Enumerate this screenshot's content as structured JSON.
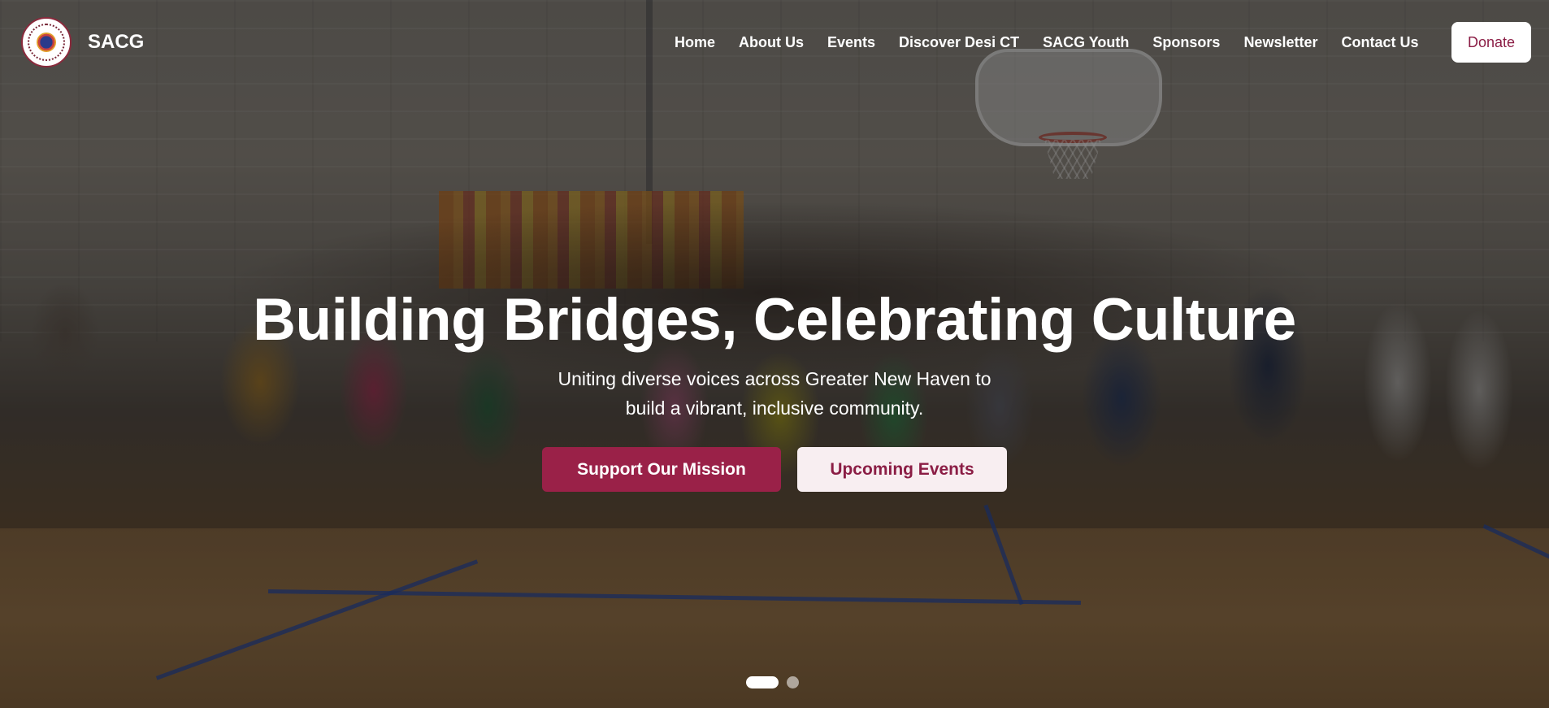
{
  "header": {
    "brand": "SACG",
    "nav": [
      "Home",
      "About Us",
      "Events",
      "Discover Desi CT",
      "SACG Youth",
      "Sponsors",
      "Newsletter",
      "Contact Us"
    ],
    "donate_label": "Donate"
  },
  "hero": {
    "title": "Building Bridges, Celebrating Culture",
    "subtitle": "Uniting diverse voices across Greater New Haven to build a vibrant, inclusive community.",
    "primary_cta": "Support Our Mission",
    "secondary_cta": "Upcoming Events",
    "slides_total": 2,
    "active_slide": 1
  },
  "colors": {
    "accent": "#9a2148",
    "accent_text": "#8b1d45",
    "secondary_bg": "#f8eef1"
  }
}
